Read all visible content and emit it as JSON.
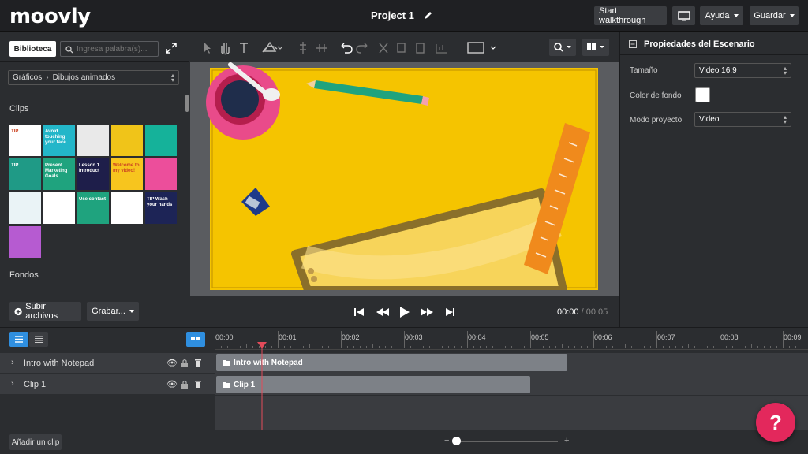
{
  "app": {
    "logo": "moovly",
    "project_title": "Project 1"
  },
  "header": {
    "walkthrough_label": "Start walkthrough",
    "help_label": "Ayuda",
    "save_label": "Guardar",
    "screen_icon": "monitor-icon"
  },
  "library": {
    "tab_label": "Biblioteca",
    "search_placeholder": "Ingresa palabra(s)...",
    "breadcrumb_root": "Gráficos",
    "breadcrumb_current": "Dibujos animados",
    "clips_label": "Clips",
    "backgrounds_label": "Fondos",
    "upload_label": "Subir archivos",
    "record_label": "Grabar...",
    "thumbs": [
      {
        "bg": "#ffffff",
        "text": "TIP"
      },
      {
        "bg": "#23b6c9",
        "text": "Avoid touching your face"
      },
      {
        "bg": "#e9e9e9",
        "text": ""
      },
      {
        "bg": "#f0c419",
        "text": ""
      },
      {
        "bg": "#15b29a",
        "text": ""
      },
      {
        "bg": "#1f9a86",
        "text": "TIP"
      },
      {
        "bg": "#1fa37e",
        "text": "Present Marketing Goals"
      },
      {
        "bg": "#1e1e4a",
        "text": "Lesson 1 Introduct"
      },
      {
        "bg": "#f7c51e",
        "text": "Welcome to my video!"
      },
      {
        "bg": "#ec4e9b",
        "text": ""
      },
      {
        "bg": "#eaf3f6",
        "text": ""
      },
      {
        "bg": "#ffffff",
        "text": ""
      },
      {
        "bg": "#1fa37e",
        "text": "Use contact"
      },
      {
        "bg": "#ffffff",
        "text": ""
      },
      {
        "bg": "#1d2456",
        "text": "TIP Wash your hands"
      },
      {
        "bg": "#b65bd1",
        "text": ""
      }
    ]
  },
  "toolbar": {
    "tools": [
      "select-icon",
      "hand-icon",
      "text-icon",
      "shape-icon",
      "align-icon",
      "distribute-icon",
      "undo-icon",
      "redo-icon",
      "cut-icon",
      "copy-icon",
      "paste-icon",
      "group-icon",
      "sequence-icon",
      "zoom-icon",
      "layout-icon"
    ]
  },
  "player": {
    "current_time": "00:00",
    "separator": "/",
    "total_time": "00:05"
  },
  "properties": {
    "title": "Propiedades del Escenario",
    "size_label": "Tamaño",
    "size_value": "Video 16:9",
    "bg_color_label": "Color de fondo",
    "bg_color": "#ffffff",
    "mode_label": "Modo proyecto",
    "mode_value": "Video"
  },
  "timeline": {
    "ticks": [
      "00:00",
      "00:01",
      "00:02",
      "00:03",
      "00:04",
      "00:05",
      "00:06",
      "00:07",
      "00:08",
      "00:09"
    ],
    "tracks": [
      {
        "name": "Intro with Notepad",
        "clip_label": "Intro with Notepad"
      },
      {
        "name": "Clip 1",
        "clip_label": "Clip 1"
      }
    ],
    "add_clip_label": "Añadir un clip",
    "zoom_minus": "−",
    "zoom_plus": "+"
  },
  "help_fab": "?",
  "colors": {
    "accent": "#e3285c",
    "stage_yellow": "#f5c400",
    "ui_blue": "#2f8fe0"
  }
}
